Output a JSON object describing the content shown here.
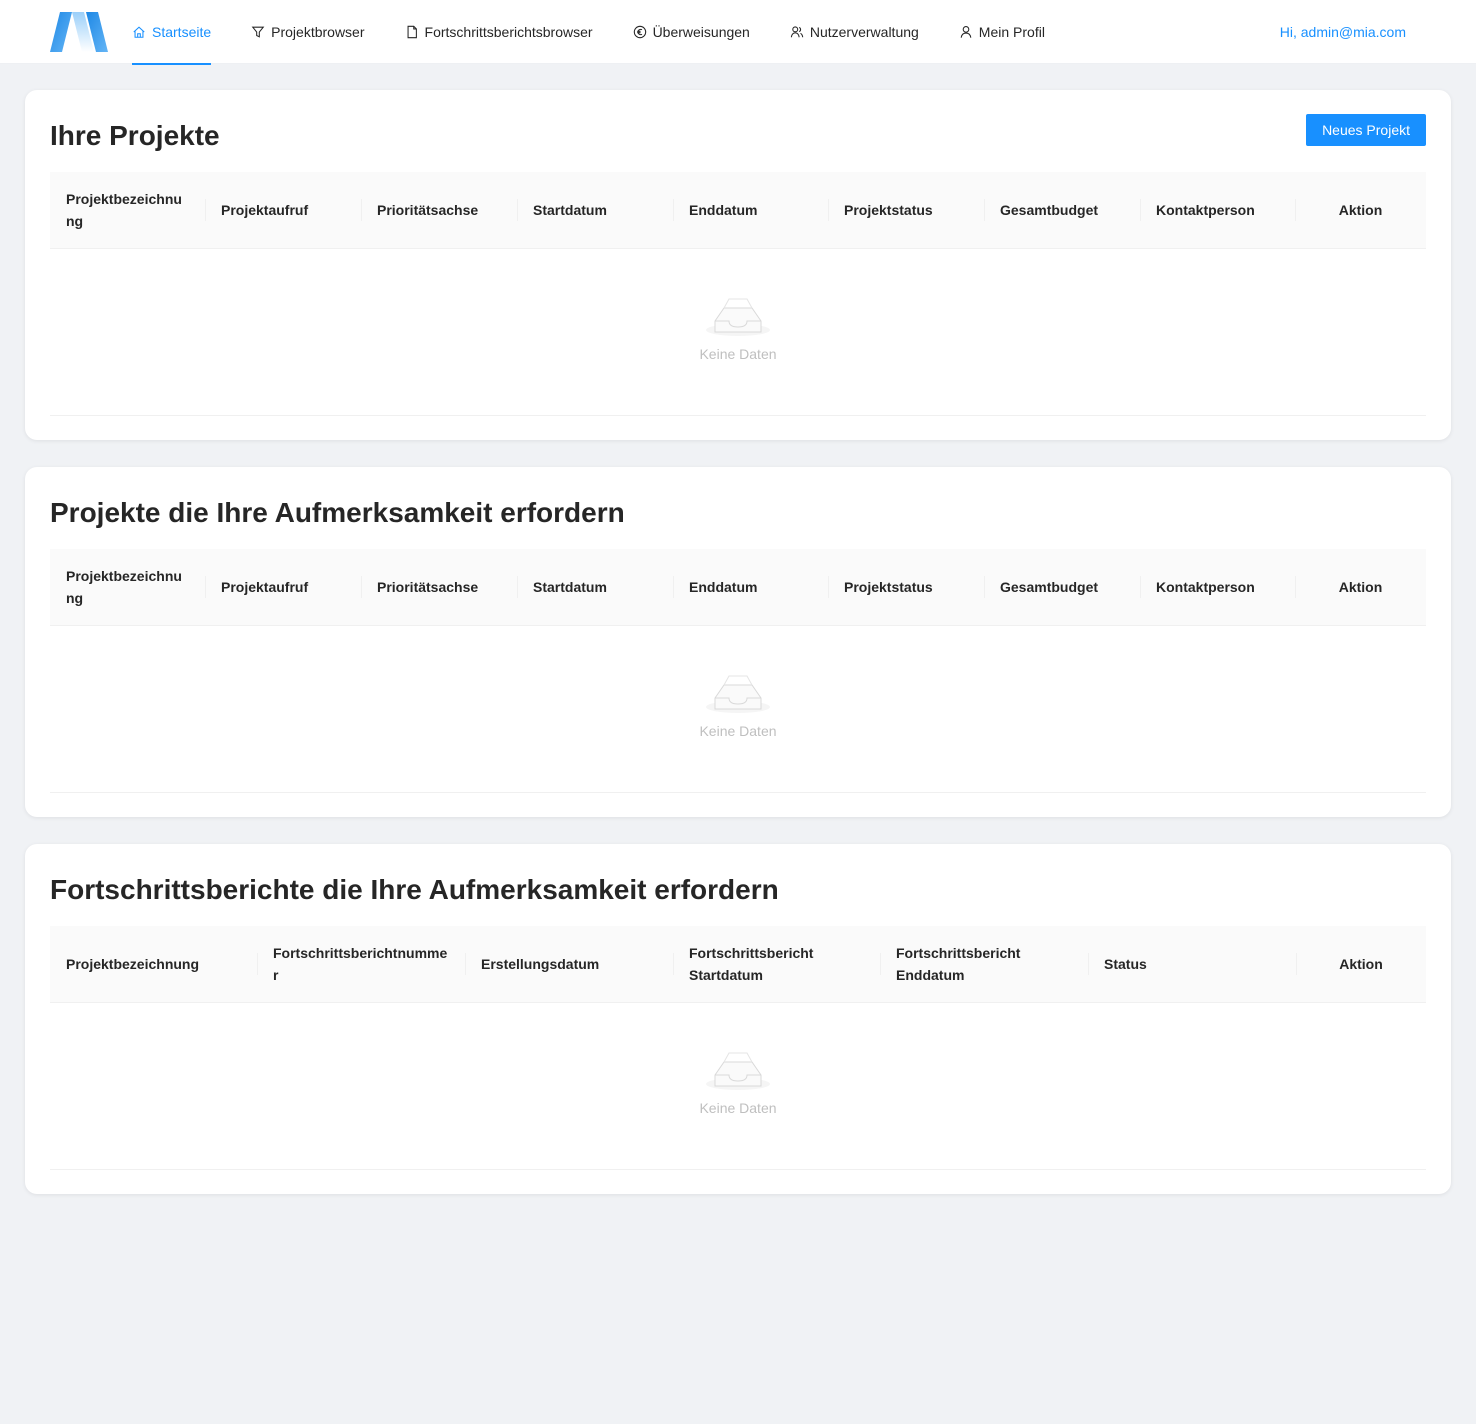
{
  "header": {
    "nav": [
      {
        "label": "Startseite",
        "icon": "home-icon",
        "active": true
      },
      {
        "label": "Projektbrowser",
        "icon": "filter-icon"
      },
      {
        "label": "Fortschrittsberichtsbrowser",
        "icon": "file-icon"
      },
      {
        "label": "Überweisungen",
        "icon": "euro-icon"
      },
      {
        "label": "Nutzerverwaltung",
        "icon": "users-icon"
      },
      {
        "label": "Mein Profil",
        "icon": "user-icon"
      }
    ],
    "greeting": "Hi, admin@mia.com"
  },
  "colors": {
    "accent": "#1890ff",
    "background": "#f0f2f5",
    "empty_text": "#bfbfbf"
  },
  "sections": {
    "your_projects": {
      "title": "Ihre Projekte",
      "new_project_button": "Neues Projekt",
      "columns": [
        "Projektbezeichnung",
        "Projektaufruf",
        "Prioritätsachse",
        "Startdatum",
        "Enddatum",
        "Projektstatus",
        "Gesamtbudget",
        "Kontaktperson",
        "Aktion"
      ],
      "empty_text": "Keine Daten"
    },
    "attention_projects": {
      "title": "Projekte die Ihre Aufmerksamkeit erfordern",
      "columns": [
        "Projektbezeichnung",
        "Projektaufruf",
        "Prioritätsachse",
        "Startdatum",
        "Enddatum",
        "Projektstatus",
        "Gesamtbudget",
        "Kontaktperson",
        "Aktion"
      ],
      "empty_text": "Keine Daten"
    },
    "attention_reports": {
      "title": "Fortschrittsberichte die Ihre Aufmerksamkeit erfordern",
      "columns": [
        "Projektbezeichnung",
        "Fortschrittsberichtnummer",
        "Erstellungsdatum",
        "Fortschrittsbericht Startdatum",
        "Fortschrittsbericht Enddatum",
        "Status",
        "Aktion"
      ],
      "empty_text": "Keine Daten"
    }
  }
}
